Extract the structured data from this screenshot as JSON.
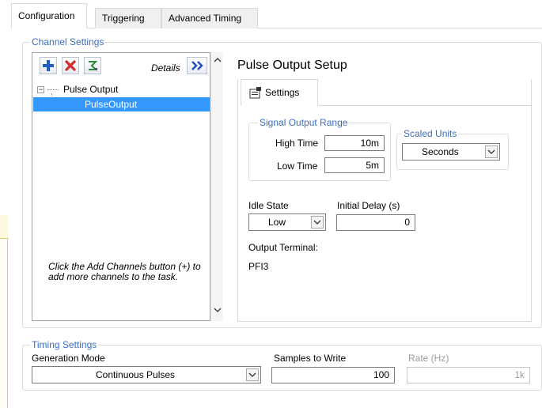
{
  "tabs": [
    "Configuration",
    "Triggering",
    "Advanced Timing"
  ],
  "channel_settings": {
    "title": "Channel Settings",
    "details_label": "Details",
    "tree": {
      "parent": "Pulse Output",
      "child": "PulseOutput"
    },
    "hint": "Click the Add Channels button (+) to add more channels to the task."
  },
  "pulse_setup": {
    "title": "Pulse Output Setup",
    "tab_label": "Settings",
    "signal_output_range": {
      "title": "Signal Output Range",
      "high_time_label": "High Time",
      "high_time_value": "10m",
      "low_time_label": "Low Time",
      "low_time_value": "5m"
    },
    "scaled_units": {
      "title": "Scaled Units",
      "value": "Seconds"
    },
    "idle_state": {
      "label": "Idle State",
      "value": "Low"
    },
    "initial_delay": {
      "label": "Initial Delay (s)",
      "value": "0"
    },
    "output_terminal": {
      "label": "Output Terminal:",
      "value": "PFI3"
    }
  },
  "timing_settings": {
    "title": "Timing Settings",
    "generation_mode_label": "Generation Mode",
    "generation_mode_value": "Continuous Pulses",
    "samples_label": "Samples to Write",
    "samples_value": "100",
    "rate_label": "Rate (Hz)",
    "rate_value": "1k"
  },
  "colors": {
    "accent_blue": "#3c6ebd",
    "selection": "#3399ff",
    "add_icon": "#1f5fbf",
    "remove_icon": "#d42a2a"
  }
}
